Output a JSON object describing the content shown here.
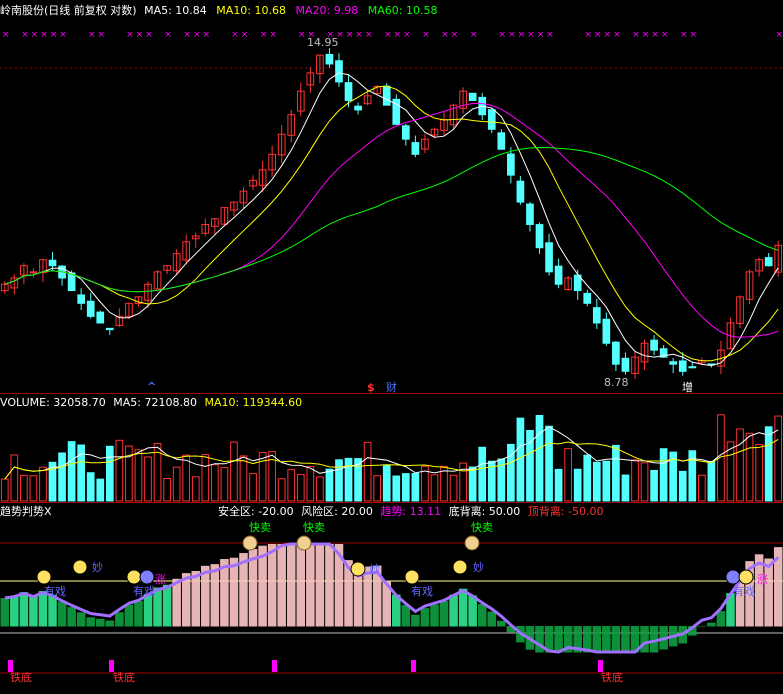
{
  "price_panel": {
    "stock_title": "岭南股份(日线 前复权 对数)",
    "ma5_label": "MA5: 10.84",
    "ma10_label": "MA10: 10.68",
    "ma20_label": "MA20: 9.98",
    "ma60_label": "MA60: 10.58",
    "high_label": "14.95",
    "low_label": "8.78",
    "marker_s": "$",
    "marker_cai": "财",
    "marker_zeng": "增",
    "marker_caret": "^",
    "colors": {
      "ma5": "#ffffff",
      "ma10": "#ffff00",
      "ma20": "#ff00ff",
      "ma60": "#00ff00",
      "up": "#ff3232",
      "down": "#54ffff"
    }
  },
  "volume_panel": {
    "vol_label": "VOLUME: 32058.70",
    "ma5_label": "MA5: 72108.80",
    "ma10_label": "MA10: 119344.60"
  },
  "indicator_panel": {
    "title": "趋势判势X",
    "safe_zone": "安全区: -20.00",
    "risk_zone": "风险区: 20.00",
    "trend": "趋势: 13.11",
    "bottom_div": "底背离: 50.00",
    "top_div": "顶背离: -50.00",
    "signal_sell": "快卖",
    "signal_play": "有戏",
    "signal_wonderful": "妙",
    "signal_rise": "涨",
    "signal_iron_bottom": "铁底",
    "signal_sell_bag": "$"
  },
  "chart_data": [
    {
      "type": "candlestick",
      "title": "岭南股份(日线 前复权 对数)",
      "y_range": [
        8.78,
        14.95
      ],
      "series": [
        {
          "name": "MA5",
          "last": 10.84
        },
        {
          "name": "MA10",
          "last": 10.68
        },
        {
          "name": "MA20",
          "last": 9.98
        },
        {
          "name": "MA60",
          "last": 10.58
        }
      ],
      "annotations": [
        "14.95",
        "8.78"
      ],
      "close": [
        10.2,
        10.3,
        10.5,
        10.4,
        10.6,
        10.5,
        10.3,
        10.1,
        9.9,
        9.7,
        9.6,
        9.5,
        9.7,
        9.9,
        10.0,
        10.2,
        10.4,
        10.5,
        10.7,
        10.9,
        11.0,
        11.2,
        11.3,
        11.5,
        11.6,
        11.8,
        12.0,
        12.2,
        12.5,
        12.9,
        13.3,
        13.8,
        14.2,
        14.6,
        14.4,
        14.0,
        13.6,
        13.4,
        13.7,
        13.9,
        13.5,
        13.1,
        12.8,
        12.5,
        12.8,
        13.0,
        13.2,
        13.5,
        13.8,
        13.6,
        13.3,
        13.0,
        12.6,
        12.1,
        11.6,
        11.2,
        10.8,
        10.4,
        10.2,
        10.3,
        10.1,
        9.9,
        9.6,
        9.3,
        9.0,
        8.9,
        9.1,
        9.3,
        9.2,
        9.1,
        9.0,
        8.9,
        8.95,
        9.05,
        9.0,
        9.2,
        9.6,
        10.0,
        10.4,
        10.6,
        10.5,
        10.84
      ]
    },
    {
      "type": "bar",
      "title": "VOLUME",
      "series": [
        {
          "name": "VOLUME",
          "last": 32058.7
        },
        {
          "name": "MA5",
          "last": 72108.8
        },
        {
          "name": "MA10",
          "last": 119344.6
        }
      ]
    },
    {
      "type": "area",
      "title": "趋势判势X",
      "series": [
        {
          "name": "安全区",
          "value": -20.0
        },
        {
          "name": "风险区",
          "value": 20.0
        },
        {
          "name": "趋势",
          "last": 13.11
        },
        {
          "name": "底背离",
          "value": 50.0
        },
        {
          "name": "顶背离",
          "value": -50.0
        }
      ]
    }
  ]
}
